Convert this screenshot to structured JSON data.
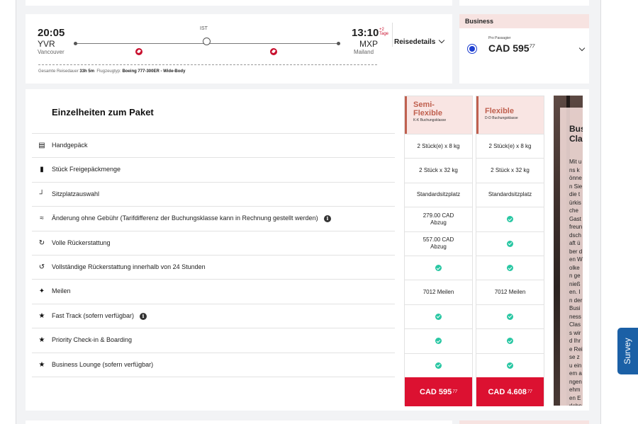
{
  "flight": {
    "dep_time": "20:05",
    "dep_code": "YVR",
    "dep_city": "Vancouver",
    "arr_time": "13:10",
    "arr_plus_days": "+2",
    "arr_days_label": "Tage",
    "arr_code": "MXP",
    "arr_city": "Mailand",
    "stop_code": "IST",
    "duration_label": "Gesamte Reisedauer",
    "duration_value": "33h 5m",
    "aircraft_label": "Flugzeugtyp:",
    "aircraft_value": "Boeing 777-300ER - Wide-Body",
    "details_button": "Reisedetails"
  },
  "fare": {
    "cabin": "Business",
    "per_passenger": "Pro Passagier",
    "price": "CAD 595",
    "price_cents": "77"
  },
  "package": {
    "title": "Einzelheiten zum Paket",
    "rows": [
      {
        "label": "Handgepäck",
        "icon": "carry-on-bag-icon"
      },
      {
        "label": "Stück Freigepäckmenge",
        "icon": "checked-bag-icon"
      },
      {
        "label": "Sitzplatzauswahl",
        "icon": "seat-icon"
      },
      {
        "label": "Änderung ohne Gebühr (Tarifdifferenz der Buchungsklasse kann in Rechnung gestellt werden)",
        "icon": "change-flight-icon"
      },
      {
        "label": "Volle Rückerstattung",
        "icon": "refund-icon"
      },
      {
        "label": "Vollständige Rückerstattung innerhalb von 24 Stunden",
        "icon": "refund-24h-icon"
      },
      {
        "label": "Meilen",
        "icon": "miles-icon"
      },
      {
        "label": "Fast Track (sofern verfügbar)",
        "icon": "star-icon"
      },
      {
        "label": "Priority Check-in & Boarding",
        "icon": "star-icon"
      },
      {
        "label": "Business Lounge (sofern verfügbar)",
        "icon": "star-icon"
      }
    ],
    "columns": [
      {
        "name": "Semi-Flexible",
        "name_line1": "Semi-",
        "name_line2": "Flexible",
        "booking_class": "K-K Buchungsklasse",
        "cells": [
          "2 Stück(e) x 8 kg",
          "2 Stück x 32 kg",
          "Standardsitzplatz",
          "279.00 CAD Abzug",
          "557.00 CAD Abzug",
          "check",
          "7012 Meilen",
          "check",
          "check",
          "check"
        ],
        "price": "CAD 595",
        "price_cents": "77"
      },
      {
        "name": "Flexible",
        "booking_class": "D-D Buchungsklasse",
        "cells": [
          "2 Stück(e) x 8 kg",
          "2 Stück x 32 kg",
          "Standardsitzplatz",
          "check",
          "check",
          "check",
          "7012 Meilen",
          "check",
          "check",
          "check"
        ],
        "price": "CAD 4.608",
        "price_cents": "77"
      }
    ],
    "business_panel": {
      "title_line1": "Busi",
      "title_line2": "Clas",
      "text": "Mit uns können Sie die türkische Gastfreundschaft über den Wolken genießen. In der Business Class wird Ihre Reise zu einem angenehmen Erlebnis mit"
    }
  },
  "colors": {
    "brand_red": "#dc1131",
    "fare_header": "#f9e5e3",
    "check_green": "#29c7a3",
    "radio_blue": "#1e3fd1",
    "survey_blue": "#1b60a6"
  },
  "survey": {
    "label": "Survey"
  }
}
